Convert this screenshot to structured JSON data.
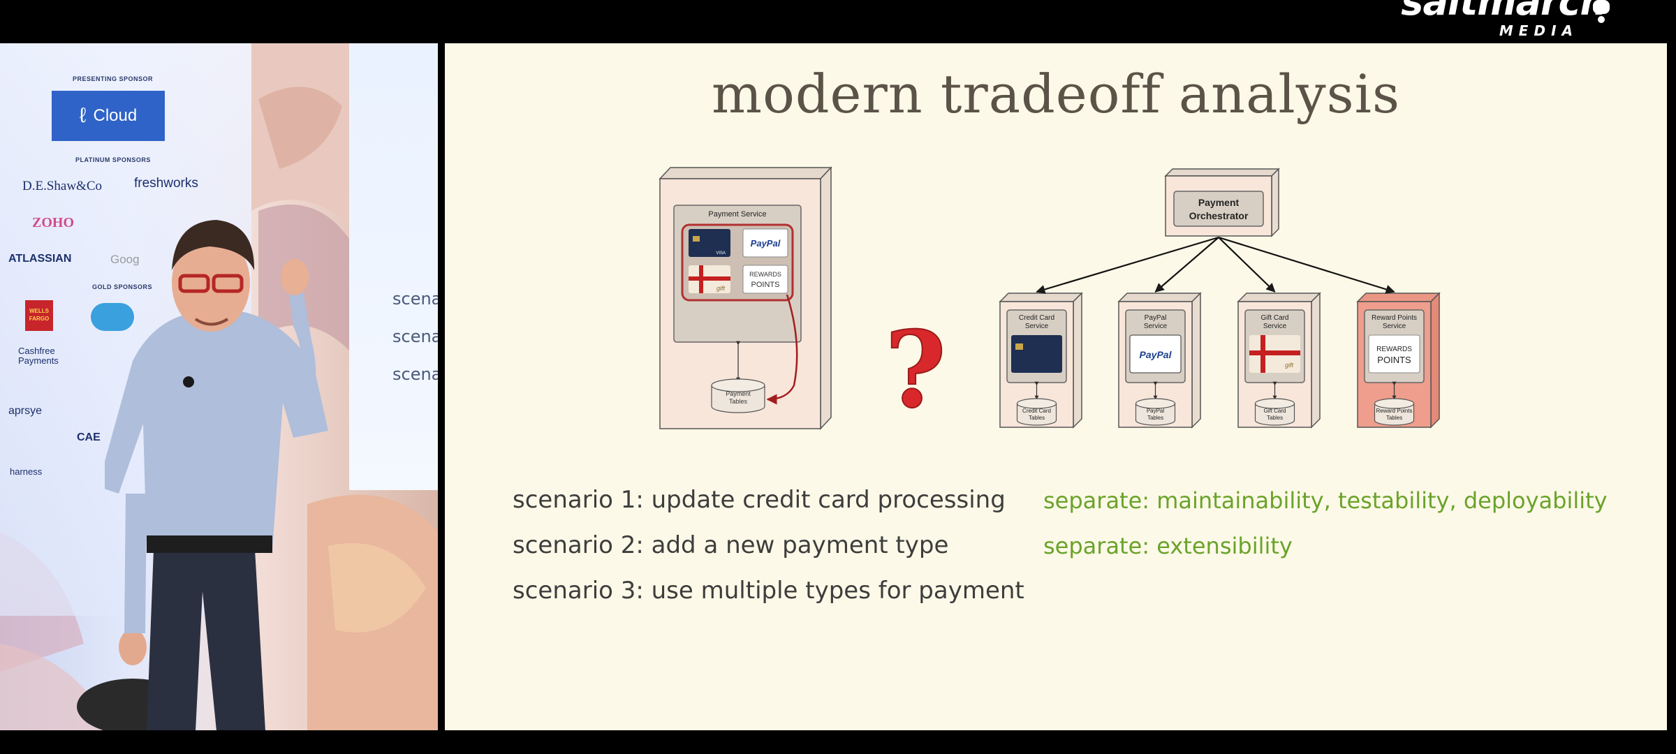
{
  "broadcast": {
    "logo_word": "saltmarch",
    "logo_sub": "MEDIA"
  },
  "venue": {
    "presenting_sponsor_label": "PRESENTING SPONSOR",
    "presenting_sponsor": "Cloud",
    "platinum_label": "PLATINUM SPONSORS",
    "platinum": [
      "D.E.Shaw&Co",
      "freshworks",
      "ZOHO",
      "ATLASSIAN",
      "Goog"
    ],
    "gold_label": "GOLD SPONSORS",
    "gold": [
      "WELLS FARGO",
      "Cashfree Payments",
      "aprsye",
      "harness",
      "CAE"
    ],
    "screen_text": [
      "scenar",
      "scenar",
      "scenar"
    ]
  },
  "slide": {
    "title": "modern tradeoff analysis",
    "monolith": {
      "service_label": "Payment Service",
      "paypal_label": "PayPal",
      "rewards_label_1": "REWARDS",
      "rewards_label_2": "POINTS",
      "gift_label": "gift",
      "visa_label": "VISA",
      "tables_label_1": "Payment",
      "tables_label_2": "Tables"
    },
    "question_mark": "?",
    "orchestrator": {
      "label_1": "Payment",
      "label_2": "Orchestrator"
    },
    "services": [
      {
        "name_1": "Credit Card",
        "name_2": "Service",
        "tables_1": "Credit Card",
        "tables_2": "Tables",
        "kind": "card",
        "highlight": false
      },
      {
        "name_1": "PayPal",
        "name_2": "Service",
        "tables_1": "PayPal",
        "tables_2": "Tables",
        "kind": "paypal",
        "highlight": false
      },
      {
        "name_1": "Gift Card",
        "name_2": "Service",
        "tables_1": "Gift Card",
        "tables_2": "Tables",
        "kind": "gift",
        "highlight": false
      },
      {
        "name_1": "Reward Points",
        "name_2": "Service",
        "tables_1": "Reward Points",
        "tables_2": "Tables",
        "kind": "rewards",
        "highlight": true
      }
    ],
    "scenarios": [
      "scenario 1: update credit card processing",
      "scenario 2: add a new payment type",
      "scenario 3: use multiple types for payment"
    ],
    "benefits": [
      "separate: maintainability, testability, deployability",
      "separate: extensibility"
    ],
    "colors": {
      "background": "#fdf9e8",
      "title": "#5b5348",
      "benefit_green": "#6aa32a",
      "question_red": "#d9282b",
      "service_fill": "#f8e6da",
      "highlight_fill": "#ef9d8c"
    }
  }
}
